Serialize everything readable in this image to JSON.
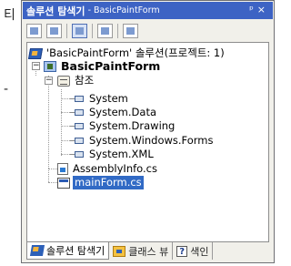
{
  "background": {
    "fragment_top": "티",
    "fragment_mid": "-"
  },
  "panel": {
    "title": "솔루션 탐색기",
    "title_suffix": "- BasicPaintForm",
    "pin_icon": "pin-icon",
    "close_glyph": "×"
  },
  "toolbar": {
    "buttons": [
      "view-code-icon",
      "view-designer-icon",
      "refresh-icon",
      "show-all-files-icon",
      "properties-icon"
    ]
  },
  "tree": {
    "solution_label": "'BasicPaintForm' 솔루션(프로젝트: 1)",
    "project_label": "BasicPaintForm",
    "references_label": "참조",
    "references": [
      "System",
      "System.Data",
      "System.Drawing",
      "System.Windows.Forms",
      "System.XML"
    ],
    "files": [
      "AssemblyInfo.cs",
      "mainForm.cs"
    ],
    "selected": "mainForm.cs"
  },
  "tabs": [
    {
      "label": "솔루션 탐색기",
      "icon": "solution-explorer-icon",
      "active": true
    },
    {
      "label": "클래스 뷰",
      "icon": "class-view-icon",
      "active": false
    },
    {
      "label": "색인",
      "icon": "help-index-icon",
      "active": false
    }
  ],
  "colors": {
    "titlebar": "#3d63c4",
    "selection": "#316ac5",
    "panel_bg": "#f1f0ea"
  }
}
